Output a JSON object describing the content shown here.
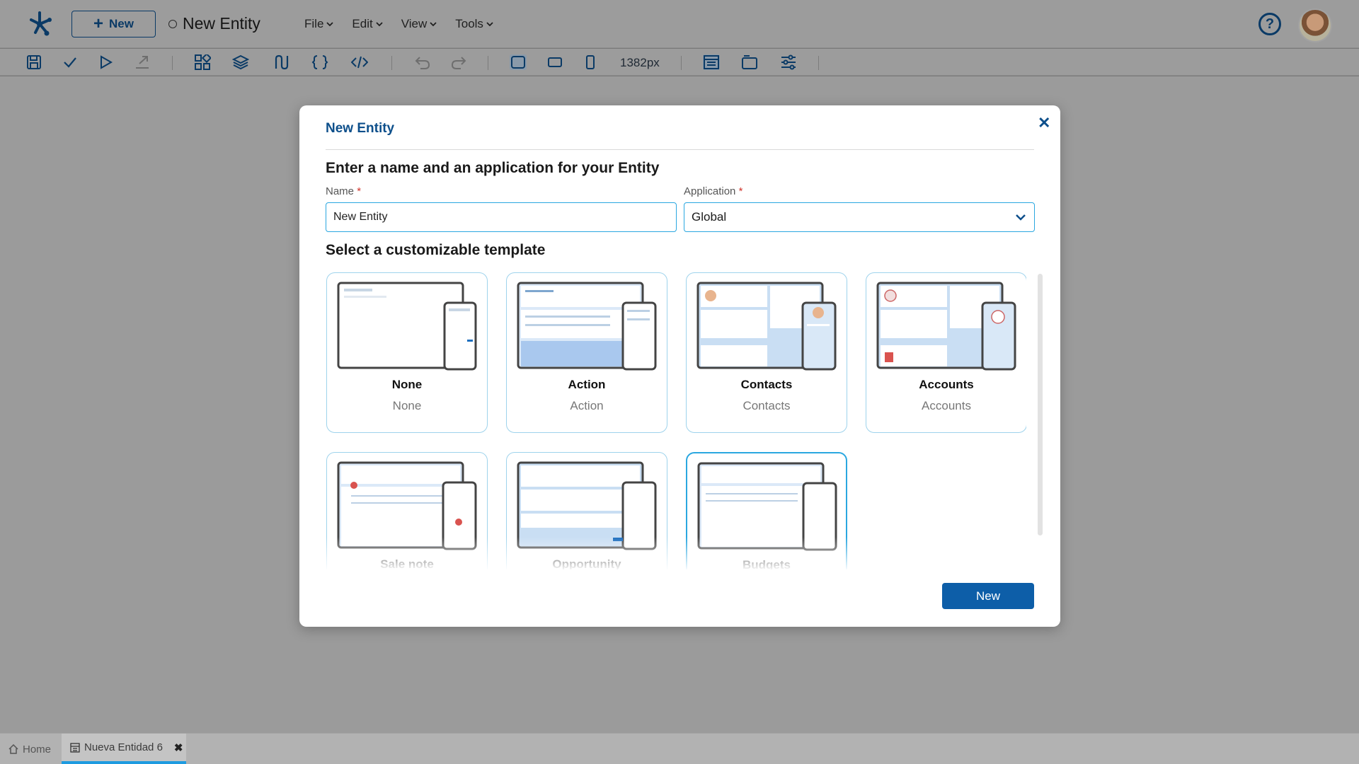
{
  "topbar": {
    "new_button_label": "New",
    "document_title": "New Entity",
    "menus": [
      "File",
      "Edit",
      "View",
      "Tools"
    ]
  },
  "toolbar": {
    "width_readout": "1382px"
  },
  "modal": {
    "title": "New Entity",
    "subtitle": "Enter a name and an application for your Entity",
    "name_label": "Name",
    "name_value": "New Entity",
    "application_label": "Application",
    "application_value": "Global",
    "required_mark": "*",
    "templates_heading": "Select a customizable template",
    "templates": [
      {
        "name": "None",
        "description": "None"
      },
      {
        "name": "Action",
        "description": "Action"
      },
      {
        "name": "Contacts",
        "description": "Contacts"
      },
      {
        "name": "Accounts",
        "description": "Accounts"
      },
      {
        "name": "Sale note",
        "description": ""
      },
      {
        "name": "Opportunity",
        "description": ""
      },
      {
        "name": "Budgets",
        "description": ""
      }
    ],
    "selected_template": "Budgets",
    "new_button_label": "New"
  },
  "bottom_tabs": {
    "home_label": "Home",
    "active_tab_label": "Nueva Entidad 6"
  },
  "colors": {
    "accent": "#0d5ea8",
    "field_border": "#2aa7e0",
    "title_blue": "#0d4f8b",
    "tab_underline": "#1e9be0"
  }
}
